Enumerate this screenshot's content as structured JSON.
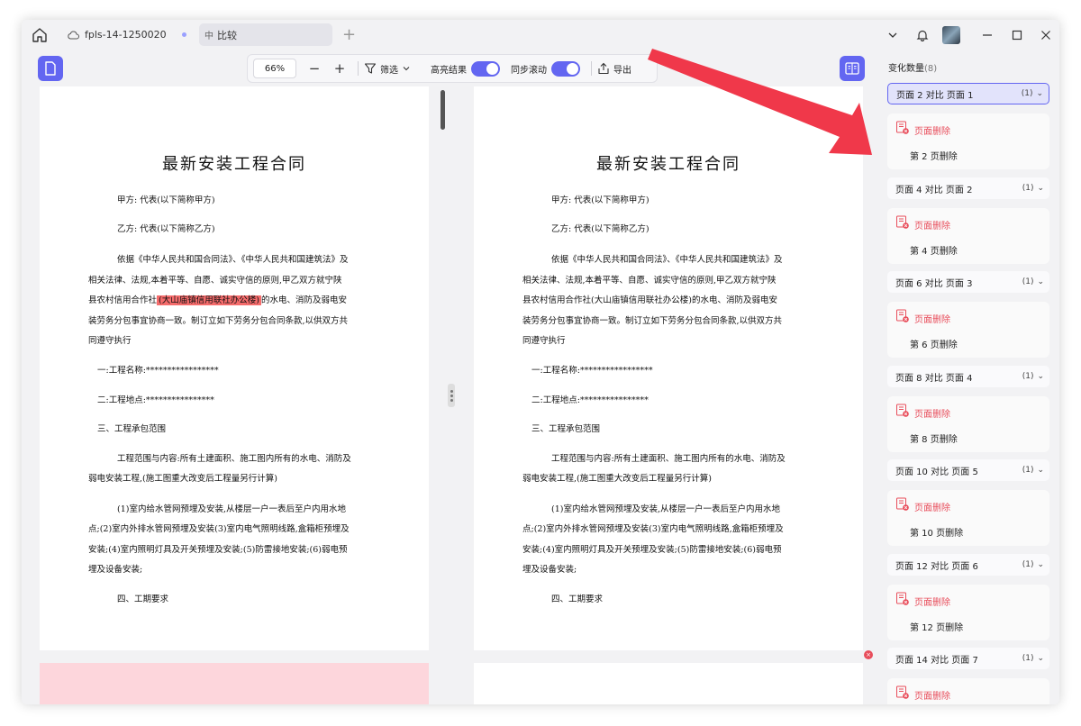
{
  "titlebar": {
    "tab_file": "fpls-14-1250020",
    "tab_compare_prefix": "中",
    "tab_compare": "比较",
    "tab_add": "+"
  },
  "toolbar": {
    "zoom": "66%",
    "zoom_out": "−",
    "zoom_in": "+",
    "filter": "筛选",
    "highlight": "高亮结果",
    "sync_scroll": "同步滚动",
    "export": "导出"
  },
  "document": {
    "title": "最新安装工程合同",
    "party_a": "甲方:  代表(以下简称甲方)",
    "party_b": "乙方:  代表(以下简称乙方)",
    "para1_l1": "依据《中华人民共和国合同法》、《中华人民共和国建筑法》及",
    "para1_l2": "相关法律、法规,本着平等、自愿、诚实守信的原则,甲乙双方就宁陕",
    "para1_l3_pre": "县农村信用合作社",
    "para1_l3_hl": "(大山庙镇信用联社办公楼)",
    "para1_l3_post": "的水电、消防及弱电安",
    "para1_l4": "装劳务分包事宜协商一致。制订立如下劳务分包合同条款,以供双方共",
    "para1_l5": "同遵守执行",
    "item1": "一:工程名称:*****************",
    "item2": "二:工程地点:****************",
    "item3": "三、工程承包范围",
    "para2_l1": "工程范围与内容:所有土建面积、施工图内所有的水电、消防及",
    "para2_l2": "弱电安装工程,(施工图重大改变后工程量另行计算)",
    "para3_l1": "(1)室内给水管网预埋及安装,从楼层一户一表后至户内用水地",
    "para3_l2": "点;(2)室内外排水管网预埋及安装(3)室内电气照明线路,盒箱柜预埋及",
    "para3_l3": "安装;(4)室内照明灯具及开关预埋及安装;(5)防雷接地安装;(6)弱电预",
    "para3_l4": "埋及设备安装;",
    "item4": "四、工期要求"
  },
  "sidebar": {
    "title": "变化数量",
    "count": "(8)",
    "groups": [
      {
        "label": "页面 2 对比 页面 1",
        "count": "(1)",
        "kind": "页面删除",
        "detail": "第 2 页删除"
      },
      {
        "label": "页面 4 对比 页面 2",
        "count": "(1)",
        "kind": "页面删除",
        "detail": "第 4 页删除"
      },
      {
        "label": "页面 6 对比 页面 3",
        "count": "(1)",
        "kind": "页面删除",
        "detail": "第 6 页删除"
      },
      {
        "label": "页面 8 对比 页面 4",
        "count": "(1)",
        "kind": "页面删除",
        "detail": "第 8 页删除"
      },
      {
        "label": "页面 10 对比 页面 5",
        "count": "(1)",
        "kind": "页面删除",
        "detail": "第 10 页删除"
      },
      {
        "label": "页面 12 对比 页面 6",
        "count": "(1)",
        "kind": "页面删除",
        "detail": "第 12 页删除"
      },
      {
        "label": "页面 14 对比 页面 7",
        "count": "(1)",
        "kind": "页面删除",
        "detail": ""
      }
    ]
  },
  "colors": {
    "accent": "#6366f1",
    "delete_red": "#e84d5b",
    "highlight": "#f56c6c",
    "arrow": "#f0384a"
  }
}
